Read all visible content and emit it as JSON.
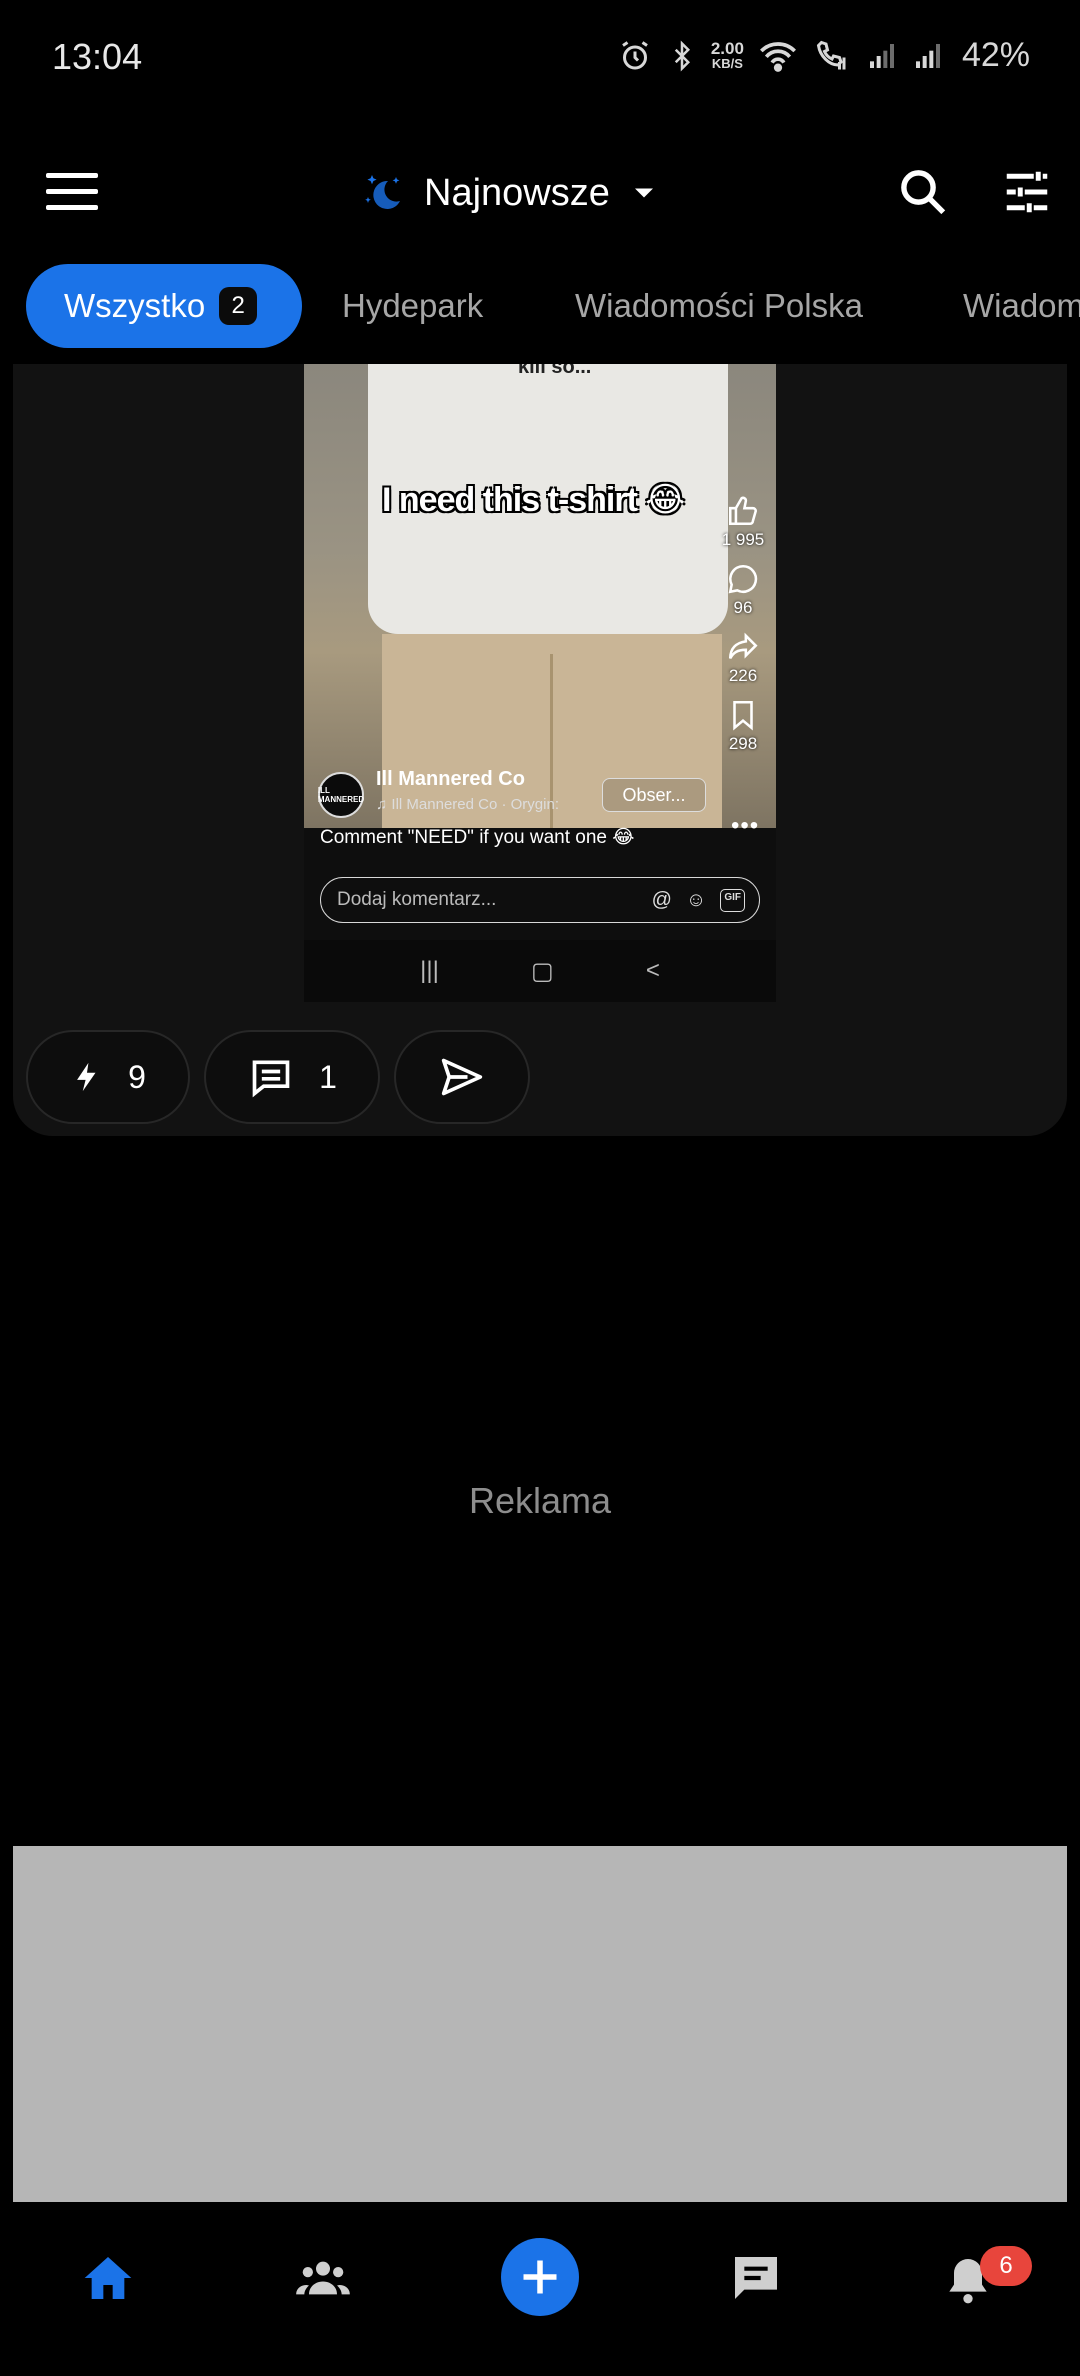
{
  "status_bar": {
    "time": "13:04",
    "speed_value": "2.00",
    "speed_unit": "KB/S",
    "battery": "42%"
  },
  "app_bar": {
    "feed_label": "Najnowsze"
  },
  "tabs": [
    {
      "label": "Wszystko",
      "count": "2",
      "active": true
    },
    {
      "label": "Hydepark"
    },
    {
      "label": "Wiadomości Polska"
    },
    {
      "label": "Wiadom"
    }
  ],
  "post": {
    "media": {
      "shirt_text": "kill so...",
      "overlay_text": "I need this t-shirt 😂",
      "likes": "1 995",
      "comments": "96",
      "shares": "226",
      "saves": "298",
      "avatar_text": "ILL MANNERED",
      "creator_name": "Ill Mannered Co",
      "music": "♫ Ill Mannered Co · Orygin:",
      "follow_label": "Obser...",
      "caption": "Comment \"NEED\" if you want one 😂",
      "comment_placeholder": "Dodaj komentarz...",
      "gif_label": "GIF"
    },
    "actions": {
      "boosts": "9",
      "comments": "1"
    }
  },
  "ad": {
    "label": "Reklama"
  },
  "bottom_nav": {
    "notifications_badge": "6"
  },
  "colors": {
    "accent": "#1b73e8",
    "badge": "#e8453c",
    "background": "#000000",
    "card": "#121212"
  }
}
